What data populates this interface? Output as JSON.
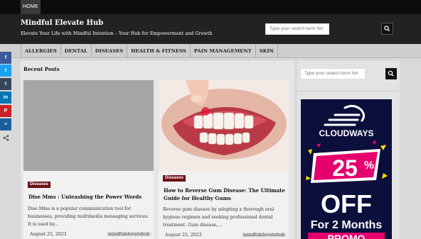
{
  "topbar": {
    "home_label": "HOME"
  },
  "header": {
    "title": "Mindful Elevate Hub",
    "tagline": "Elevate Your Life with Mindful Intention – Your Hub for Empowerment and Growth",
    "search_placeholder": "Type your search term her"
  },
  "menu": {
    "items": [
      {
        "label": "ALLERGIES"
      },
      {
        "label": "DENTAL"
      },
      {
        "label": "DISEASES"
      },
      {
        "label": "HEALTH & FITNESS"
      },
      {
        "label": "PAIN MANAGEMENT"
      },
      {
        "label": "SKIN"
      }
    ]
  },
  "share": {
    "buttons": [
      {
        "name": "facebook",
        "glyph": "f",
        "color": "#3b5998"
      },
      {
        "name": "twitter",
        "glyph": "t",
        "color": "#1da1f2"
      },
      {
        "name": "tumblr",
        "glyph": "t",
        "color": "#35465c"
      },
      {
        "name": "linkedin",
        "glyph": "in",
        "color": "#0077b5"
      },
      {
        "name": "pinterest",
        "glyph": "P",
        "color": "#cb2027"
      },
      {
        "name": "buffer",
        "glyph": "≡",
        "color": "#1b5e9c"
      },
      {
        "name": "share",
        "glyph": "<",
        "color": "#444444"
      }
    ]
  },
  "main": {
    "heading": "Recent Posts",
    "posts": [
      {
        "category": "Diseases",
        "title": "Dise Mms : Unleashing the Power Words",
        "excerpt": "Dise Mms is a popular communication tool for businesses, providing multimedia messaging services. It is used by...",
        "date": "August 25, 2023",
        "author": "mindfulelevatehub"
      },
      {
        "category": "Diseases",
        "title": "How to Reverse Gum Disease: The Ultimate Guide for Healthy Gums",
        "excerpt": "Reverse gum disease by adopting a thorough oral hygiene regimen and seeking professional dental treatment. Gum disease,...",
        "date": "August 25, 2023",
        "author": "mindfulelevatehub"
      }
    ]
  },
  "sidebar": {
    "search_placeholder": "Type your search term her",
    "ad": {
      "brand": "CLOUDWAYS",
      "discount": "25",
      "percent": "%",
      "off": "OFF",
      "duration": "For 2 Months",
      "promo": "PROMO"
    }
  },
  "colors": {
    "header_bg": "#222222",
    "badge": "#6d0e12",
    "ad_bg": "#0b0f3c",
    "ad_accent": "#e6006e",
    "ad_yellow": "#ffe000"
  }
}
